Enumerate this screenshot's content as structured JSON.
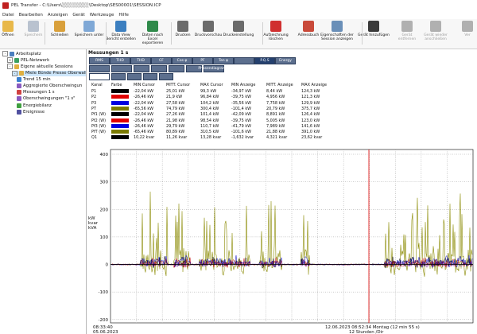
{
  "window": {
    "title": "PEL Transfer - C:\\Users\\░░░░░░░░\\Desktop\\SES00001\\SESSION.ICP"
  },
  "menu": [
    "Datei",
    "Bearbeiten",
    "Anzeigen",
    "Gerät",
    "Werkzeuge",
    "Hilfe"
  ],
  "toolbar": [
    {
      "label": "Öffnen",
      "icon": "folder-icon",
      "enabled": true,
      "color": "#e8b84a"
    },
    {
      "label": "Speichern",
      "icon": "save-icon",
      "enabled": false,
      "color": "#b9c2cf"
    },
    {
      "label": "Schließen",
      "icon": "close-session-icon",
      "enabled": true,
      "color": "#d9a03b"
    },
    {
      "label": "Speichern unter",
      "icon": "save-as-icon",
      "enabled": true,
      "color": "#7fa8d6"
    },
    {
      "label": "Data View Bericht erstellen",
      "icon": "report-icon",
      "enabled": true,
      "color": "#3c7fc0"
    },
    {
      "label": "Daten nach Excel exportieren",
      "icon": "excel-export-icon",
      "enabled": true,
      "color": "#2f8a4a"
    },
    {
      "label": "Drucken",
      "icon": "printer-icon",
      "enabled": true,
      "color": "#6b6b6b"
    },
    {
      "label": "Druckvorschau",
      "icon": "print-preview-icon",
      "enabled": true,
      "color": "#6b6b6b"
    },
    {
      "label": "Druckeinstellung",
      "icon": "print-settings-icon",
      "enabled": true,
      "color": "#6b6b6b"
    },
    {
      "label": "Aufzeichnung löschen",
      "icon": "delete-record-icon",
      "enabled": true,
      "color": "#d03030"
    },
    {
      "label": "Adressbuch",
      "icon": "address-book-icon",
      "enabled": true,
      "color": "#c94a3a"
    },
    {
      "label": "Eigenschaften der Session anzeigen",
      "icon": "properties-icon",
      "enabled": true,
      "color": "#6a8fb8"
    },
    {
      "label": "Gerät hinzufügen",
      "icon": "add-device-icon",
      "enabled": true,
      "color": "#3a3a3a"
    },
    {
      "label": "Gerät entfernen",
      "icon": "remove-device-icon",
      "enabled": false,
      "color": "#b0b0b0"
    },
    {
      "label": "Gerät wieder anschließen",
      "icon": "reconnect-device-icon",
      "enabled": false,
      "color": "#b0b0b0"
    },
    {
      "label": "Ver",
      "icon": "more-icon",
      "enabled": false,
      "color": "#b0b0b0"
    }
  ],
  "tree": [
    {
      "label": "Arbeitsplatz",
      "level": 0,
      "icon": "computer-icon",
      "toggle": "-"
    },
    {
      "label": "PEL-Netzwerk",
      "level": 1,
      "icon": "network-icon",
      "toggle": "+"
    },
    {
      "label": "Eigene aktuelle Sessions",
      "level": 1,
      "icon": "sessions-icon",
      "toggle": "-"
    },
    {
      "label": "Miele Bünde Presse Oberwallen1",
      "level": 2,
      "icon": "session-folder-icon",
      "toggle": "-",
      "selected": true
    },
    {
      "label": "Trend 15 min",
      "level": 3,
      "icon": "trend-icon"
    },
    {
      "label": "Aggregierte Oberschwingun",
      "level": 3,
      "icon": "harmonics-icon"
    },
    {
      "label": "Messungen 1 s",
      "level": 3,
      "icon": "measure-icon"
    },
    {
      "label": "Oberschwingungen \"1 s\"",
      "level": 3,
      "icon": "harmonics-icon"
    },
    {
      "label": "Energiebilanz",
      "level": 3,
      "icon": "energy-icon"
    },
    {
      "label": "Ereignisse",
      "level": 3,
      "icon": "events-icon"
    }
  ],
  "panel": {
    "title": "Messungen 1 s"
  },
  "channels": [
    "RMS",
    "THD",
    "THD",
    "CF",
    "Cos φ",
    "PF",
    "Tan φ",
    "",
    "P.Q.S",
    "Energy"
  ],
  "channels_row2": [
    "",
    "",
    "",
    "",
    "",
    "",
    "Phasendiagramm"
  ],
  "table": {
    "headers": [
      "Kanal",
      "Farbe",
      "MIN Cursor",
      "MITT. Cursor",
      "MAX Cursor",
      "MIN Anzeige",
      "MITT. Anzeige",
      "MAX Anzeige"
    ],
    "rows": [
      {
        "kanal": "P1",
        "color": "#000000",
        "min_cursor": "-22,04 kW",
        "mitt_cursor": "25,01 kW",
        "max_cursor": "99,3 kW",
        "min_anzeige": "-34,97 kW",
        "mitt_anzeige": "8,44 kW",
        "max_anzeige": "124,3 kW"
      },
      {
        "kanal": "P2",
        "color": "#e00000",
        "min_cursor": "-26,46 kW",
        "mitt_cursor": "21,9 kW",
        "max_cursor": "96,84 kW",
        "min_anzeige": "-39,75 kW",
        "mitt_anzeige": "4,956 kW",
        "max_anzeige": "121,3 kW"
      },
      {
        "kanal": "P3",
        "color": "#0000e0",
        "min_cursor": "-22,04 kW",
        "mitt_cursor": "27,58 kW",
        "max_cursor": "104,2 kW",
        "min_anzeige": "-35,56 kW",
        "mitt_anzeige": "7,758 kW",
        "max_anzeige": "129,9 kW"
      },
      {
        "kanal": "PT",
        "color": "#7a7a00",
        "min_cursor": "-65,56 kW",
        "mitt_cursor": "74,79 kW",
        "max_cursor": "300,4 kW",
        "min_anzeige": "-101,4 kW",
        "mitt_anzeige": "20,79 kW",
        "max_anzeige": "375,7 kW"
      },
      {
        "kanal": "Pf1 (W)",
        "color": "#000000",
        "min_cursor": "-22,04 kW",
        "mitt_cursor": "27,26 kW",
        "max_cursor": "101,4 kW",
        "min_anzeige": "-42,09 kW",
        "mitt_anzeige": "8,891 kW",
        "max_anzeige": "126,4 kW"
      },
      {
        "kanal": "Pf2 (W)",
        "color": "#e00000",
        "min_cursor": "-26,46 kW",
        "mitt_cursor": "21,98 kW",
        "max_cursor": "98,54 kW",
        "min_anzeige": "-39,75 kW",
        "mitt_anzeige": "5,005 kW",
        "max_anzeige": "123,0 kW"
      },
      {
        "kanal": "Pf3 (W)",
        "color": "#0000e0",
        "min_cursor": "-26,46 kW",
        "mitt_cursor": "29,79 kW",
        "max_cursor": "110,7 kW",
        "min_anzeige": "-41,79 kW",
        "mitt_anzeige": "7,989 kW",
        "max_anzeige": "141,6 kW"
      },
      {
        "kanal": "PfT (W)",
        "color": "#7a7a00",
        "min_cursor": "-65,46 kW",
        "mitt_cursor": "80,89 kW",
        "max_cursor": "310,5 kW",
        "min_anzeige": "-101,6 kW",
        "mitt_anzeige": "21,88 kW",
        "max_anzeige": "391,0 kW"
      },
      {
        "kanal": "Q1",
        "color": "#000000",
        "min_cursor": "10,22 kvar",
        "mitt_cursor": "11,26 kvar",
        "max_cursor": "13,28 kvar",
        "min_anzeige": "-1,632 kvar",
        "mitt_anzeige": "4,321 kvar",
        "max_anzeige": "23,62 kvar"
      }
    ],
    "row_partial": "Q2"
  },
  "graph": {
    "y_axis_label": [
      "kW",
      "kvar",
      "kVA"
    ],
    "y_ticks": [
      "400",
      "300",
      "200",
      "100",
      "0",
      "-100",
      "-200"
    ],
    "x_start_label": [
      "08:33:40",
      "05.06.2023"
    ],
    "cursor_label": "12.06.2023 08:52:34 Montag (12 min 55 s)",
    "x_span_label": "12 Stunden /Dir"
  }
}
